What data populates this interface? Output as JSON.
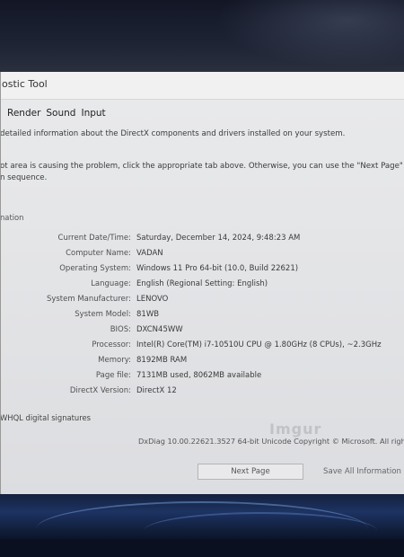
{
  "window": {
    "title": "ostic Tool"
  },
  "tabs": [
    "Render",
    "Sound",
    "Input"
  ],
  "intro": "detailed information about the DirectX components and drivers installed on your system.",
  "hint": {
    "line1": "ot area is causing the problem, click the appropriate tab above.  Otherwise, you can use the \"Next Page\" button",
    "line2": "n sequence."
  },
  "group_label": "nation",
  "system_info": [
    {
      "label": "Current Date/Time:",
      "value": "Saturday, December 14, 2024, 9:48:23 AM"
    },
    {
      "label": "Computer Name:",
      "value": "VADAN"
    },
    {
      "label": "Operating System:",
      "value": "Windows 11 Pro 64-bit (10.0, Build 22621)"
    },
    {
      "label": "Language:",
      "value": "English (Regional Setting: English)"
    },
    {
      "label": "System Manufacturer:",
      "value": "LENOVO"
    },
    {
      "label": "System Model:",
      "value": "81WB"
    },
    {
      "label": "BIOS:",
      "value": "DXCN45WW"
    },
    {
      "label": "Processor:",
      "value": "Intel(R) Core(TM) i7-10510U CPU @ 1.80GHz (8 CPUs), ~2.3GHz"
    },
    {
      "label": "Memory:",
      "value": "8192MB RAM"
    },
    {
      "label": "Page file:",
      "value": "7131MB used, 8062MB available"
    },
    {
      "label": "DirectX Version:",
      "value": "DirectX 12"
    }
  ],
  "whql": "WHQL digital signatures",
  "copyright": "DxDiag 10.00.22621.3527 64-bit Unicode  Copyright © Microsoft. All righ",
  "buttons": {
    "next_page": "Next Page",
    "save_all": "Save All Information"
  }
}
